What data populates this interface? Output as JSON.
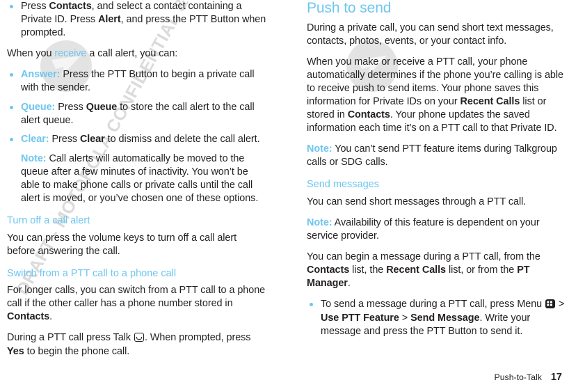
{
  "document": {
    "watermark": "DRAFT - MOTOROLA CONFIDENTIAL & PROPRIETARY INFORMATION",
    "logo_name": "motorola-batwing-logo"
  },
  "colors": {
    "accent_blue": "#6ec6ef",
    "body_text": "#231f20",
    "watermark_gray": "#cfcfcf"
  },
  "left_column": {
    "bullets_top": [
      {
        "segments": [
          {
            "text": "Press ",
            "style": "normal"
          },
          {
            "text": "Contacts",
            "style": "bold"
          },
          {
            "text": ", and select a contact containing a Private ID. Press ",
            "style": "normal"
          },
          {
            "text": "Alert",
            "style": "bold"
          },
          {
            "text": ", and press the PTT Button when prompted.",
            "style": "normal"
          }
        ]
      }
    ],
    "intro": {
      "before": "When you ",
      "blue_word": "receive",
      "after": " a call alert, you can:"
    },
    "option_bullets": [
      {
        "label": "Answer:",
        "segments": [
          {
            "text": " Press the PTT Button to begin a private call with the sender.",
            "style": "normal"
          }
        ]
      },
      {
        "label": "Queue:",
        "segments": [
          {
            "text": " Press ",
            "style": "normal"
          },
          {
            "text": "Queue",
            "style": "bold"
          },
          {
            "text": " to store the call alert to the call alert queue.",
            "style": "normal"
          }
        ]
      },
      {
        "label": "Clear:",
        "segments": [
          {
            "text": " Press ",
            "style": "normal"
          },
          {
            "text": "Clear",
            "style": "bold"
          },
          {
            "text": " to dismiss and delete the call alert.",
            "style": "normal"
          }
        ]
      }
    ],
    "nested_note": {
      "lead": "Note:",
      "text": " Call alerts will automatically be moved to the queue after a few minutes of inactivity. You won’t be able to make phone calls or private calls until the call alert is moved, or you’ve chosen one of these options."
    },
    "heading_turn_off": "Turn off a call alert",
    "para_turn_off": "You can press the volume keys to turn off a call alert before answering the call.",
    "heading_switch": "Switch from a PTT call to a phone call",
    "para_switch": {
      "segments": [
        {
          "text": "For longer calls, you can switch from a PTT call to a phone call if the other caller has a phone number stored in ",
          "style": "normal"
        },
        {
          "text": "Contacts",
          "style": "bold"
        },
        {
          "text": ".",
          "style": "normal"
        }
      ]
    },
    "para_during": {
      "before": "During a PTT call press Talk ",
      "icon": "talk-key-icon",
      "middle": ". When prompted, press ",
      "bold": "Yes",
      "after": " to begin the phone call."
    }
  },
  "right_column": {
    "heading_push_to_send": "Push to send",
    "para_1": "During a private call, you can send short text messages, contacts, photos, events, or your contact info.",
    "para_2": {
      "segments": [
        {
          "text": "When you make or receive a PTT call, your phone automatically determines if the phone you’re calling is able to receive push to send items. Your phone saves this information for Private IDs on your ",
          "style": "normal"
        },
        {
          "text": "Recent Calls",
          "style": "bold"
        },
        {
          "text": " list or stored in ",
          "style": "normal"
        },
        {
          "text": "Contacts",
          "style": "bold"
        },
        {
          "text": ". Your phone updates the saved information each time it’s on a PTT call to that Private ID.",
          "style": "normal"
        }
      ]
    },
    "note_1": {
      "lead": "Note:",
      "text": " You can’t send PTT feature items during Talkgroup calls or SDG calls."
    },
    "heading_send_messages": "Send messages",
    "para_3": "You can send short messages through a PTT call.",
    "note_2": {
      "lead": "Note:",
      "text": " Availability of this feature is dependent on your service provider."
    },
    "para_4": {
      "segments": [
        {
          "text": "You can begin a message during a PTT call, from the ",
          "style": "normal"
        },
        {
          "text": "Contacts",
          "style": "bold"
        },
        {
          "text": " list, the ",
          "style": "normal"
        },
        {
          "text": "Recent Calls",
          "style": "bold"
        },
        {
          "text": " list, or from the ",
          "style": "normal"
        },
        {
          "text": "PT Manager",
          "style": "bold"
        },
        {
          "text": ".",
          "style": "normal"
        }
      ]
    },
    "bullet_send": {
      "before": "To send a message during a PTT call, press Menu ",
      "icon": "menu-key-icon",
      "sep_1": " > ",
      "bold_1": "Use PTT Feature",
      "sep_2": " > ",
      "bold_2": "Send Message",
      "after": ". Write your message and press the PTT Button to send it."
    }
  },
  "footer": {
    "section": "Push-to-Talk",
    "page_number": "17"
  }
}
